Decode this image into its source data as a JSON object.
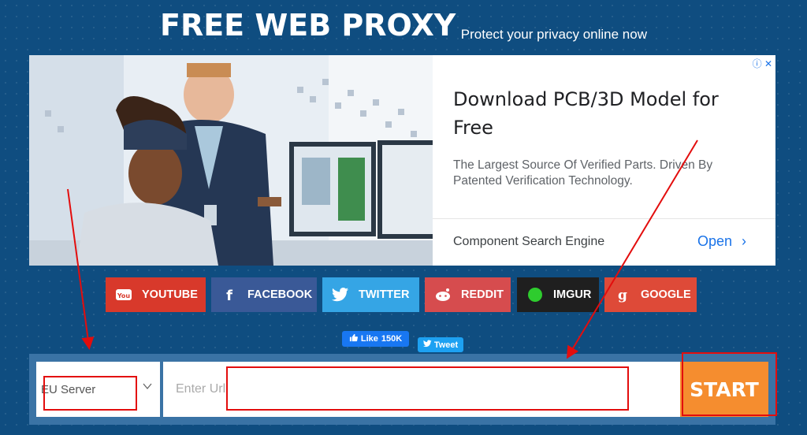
{
  "header": {
    "title": "FREE WEB PROXY",
    "subtitle": "Protect your privacy online now"
  },
  "ad": {
    "headline": "Download PCB/3D Model for Free",
    "description": "The Largest Source Of Verified Parts. Driven By Patented Verification Technology.",
    "cta_text": "Component Search Engine",
    "open_label": "Open",
    "open_chevron": "›",
    "close_icons": "ⓘ ✕"
  },
  "share_buttons": [
    {
      "label": "YOUTUBE",
      "icon": "youtube-icon",
      "color": "#d8392b"
    },
    {
      "label": "FACEBOOK",
      "icon": "facebook-icon",
      "color": "#3a5997"
    },
    {
      "label": "TWITTER",
      "icon": "twitter-icon",
      "color": "#35a5e5"
    },
    {
      "label": "REDDIT",
      "icon": "reddit-icon",
      "color": "#d64c4e"
    },
    {
      "label": "IMGUR",
      "icon": "imgur-icon",
      "color": "#1f1f1f"
    },
    {
      "label": "GOOGLE",
      "icon": "google-icon",
      "color": "#de4a38"
    }
  ],
  "social": {
    "like_label": "Like",
    "like_count": "150K",
    "tweet_label": "Tweet"
  },
  "form": {
    "server_value": "EU Server",
    "url_placeholder": "Enter Url",
    "start_label": "START"
  },
  "colors": {
    "background": "#0f4d80",
    "panel": "#3a73a5",
    "start": "#f58d2f",
    "annotation": "#e30d0d"
  }
}
